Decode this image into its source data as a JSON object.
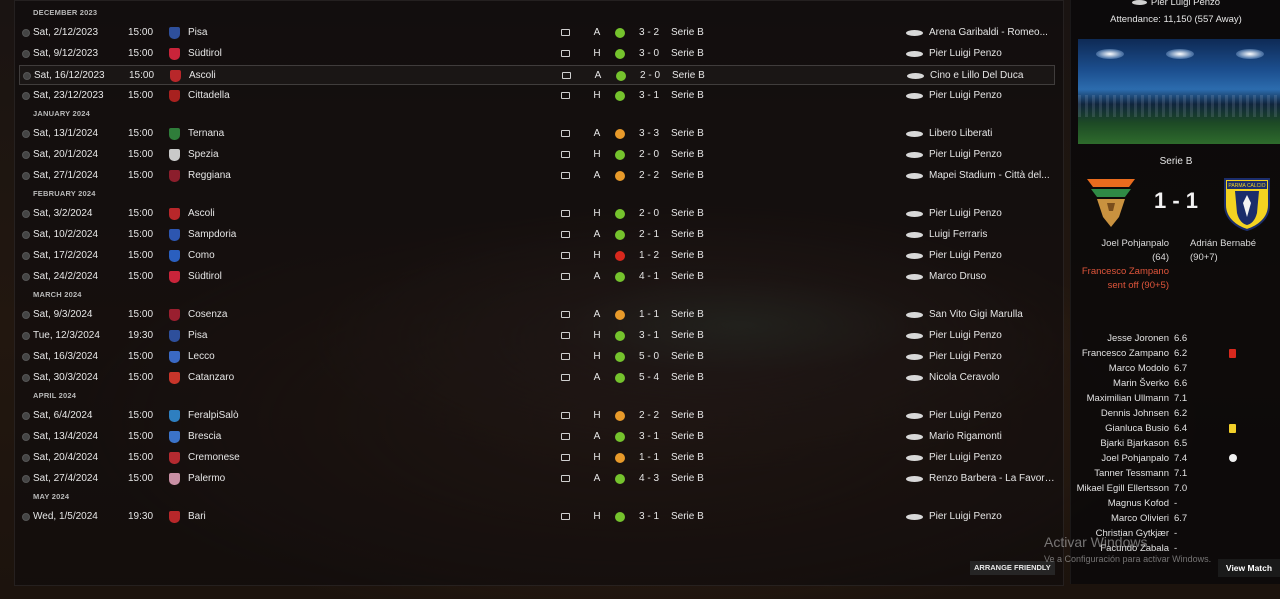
{
  "fixtures": {
    "months": [
      {
        "label": "DECEMBER 2023",
        "matches": [
          {
            "date": "Sat, 2/12/2023",
            "time": "15:00",
            "opponent": "Pisa",
            "badge_color": "#2e4f9b",
            "tv": "tv-icon",
            "venue": "A",
            "result": "win",
            "score": "3 - 2",
            "competition": "Serie B",
            "stadium": "Arena Garibaldi - Romeo..."
          },
          {
            "date": "Sat, 9/12/2023",
            "time": "15:00",
            "opponent": "Südtirol",
            "badge_color": "#c9243a",
            "tv": "tv-icon",
            "venue": "H",
            "result": "win",
            "score": "3 - 0",
            "competition": "Serie B",
            "stadium": "Pier Luigi Penzo"
          },
          {
            "date": "Sat, 16/12/2023",
            "time": "15:00",
            "opponent": "Ascoli",
            "badge_color": "#b8272a",
            "tv": "tv-icon",
            "venue": "A",
            "result": "win",
            "score": "2 - 0",
            "competition": "Serie B",
            "stadium": "Cino e Lillo Del Duca",
            "selected": true
          },
          {
            "date": "Sat, 23/12/2023",
            "time": "15:00",
            "opponent": "Cittadella",
            "badge_color": "#a8211f",
            "tv": "tv-icon",
            "venue": "H",
            "result": "win",
            "score": "3 - 1",
            "competition": "Serie B",
            "stadium": "Pier Luigi Penzo"
          }
        ]
      },
      {
        "label": "JANUARY 2024",
        "matches": [
          {
            "date": "Sat, 13/1/2024",
            "time": "15:00",
            "opponent": "Ternana",
            "badge_color": "#2f7d3a",
            "tv": "tv-icon",
            "venue": "A",
            "result": "draw",
            "score": "3 - 3",
            "competition": "Serie B",
            "stadium": "Libero Liberati"
          },
          {
            "date": "Sat, 20/1/2024",
            "time": "15:00",
            "opponent": "Spezia",
            "badge_color": "#c9c9c9",
            "tv": "tv-icon",
            "venue": "H",
            "result": "win",
            "score": "2 - 0",
            "competition": "Serie B",
            "stadium": "Pier Luigi Penzo"
          },
          {
            "date": "Sat, 27/1/2024",
            "time": "15:00",
            "opponent": "Reggiana",
            "badge_color": "#8c1e2c",
            "tv": "tv-icon",
            "venue": "A",
            "result": "draw",
            "score": "2 - 2",
            "competition": "Serie B",
            "stadium": "Mapei Stadium - Città del..."
          }
        ]
      },
      {
        "label": "FEBRUARY 2024",
        "matches": [
          {
            "date": "Sat, 3/2/2024",
            "time": "15:00",
            "opponent": "Ascoli",
            "badge_color": "#b8272a",
            "tv": "tv-icon",
            "venue": "H",
            "result": "win",
            "score": "2 - 0",
            "competition": "Serie B",
            "stadium": "Pier Luigi Penzo"
          },
          {
            "date": "Sat, 10/2/2024",
            "time": "15:00",
            "opponent": "Sampdoria",
            "badge_color": "#2d56b0",
            "tv": "tv-icon",
            "venue": "A",
            "result": "win",
            "score": "2 - 1",
            "competition": "Serie B",
            "stadium": "Luigi Ferraris"
          },
          {
            "date": "Sat, 17/2/2024",
            "time": "15:00",
            "opponent": "Como",
            "badge_color": "#2a5fbf",
            "tv": "tv-icon",
            "venue": "H",
            "result": "loss",
            "score": "1 - 2",
            "competition": "Serie B",
            "stadium": "Pier Luigi Penzo"
          },
          {
            "date": "Sat, 24/2/2024",
            "time": "15:00",
            "opponent": "Südtirol",
            "badge_color": "#c9243a",
            "tv": "tv-icon",
            "venue": "A",
            "result": "win",
            "score": "4 - 1",
            "competition": "Serie B",
            "stadium": "Marco Druso"
          }
        ]
      },
      {
        "label": "MARCH 2024",
        "matches": [
          {
            "date": "Sat, 9/3/2024",
            "time": "15:00",
            "opponent": "Cosenza",
            "badge_color": "#9a1f2f",
            "tv": "tv-icon",
            "venue": "A",
            "result": "draw",
            "score": "1 - 1",
            "competition": "Serie B",
            "stadium": "San Vito Gigi Marulla"
          },
          {
            "date": "Tue, 12/3/2024",
            "time": "19:30",
            "opponent": "Pisa",
            "badge_color": "#2e4f9b",
            "tv": "tv-icon",
            "venue": "H",
            "result": "win",
            "score": "3 - 1",
            "competition": "Serie B",
            "stadium": "Pier Luigi Penzo"
          },
          {
            "date": "Sat, 16/3/2024",
            "time": "15:00",
            "opponent": "Lecco",
            "badge_color": "#3a69c4",
            "tv": "tv-icon",
            "venue": "H",
            "result": "win",
            "score": "5 - 0",
            "competition": "Serie B",
            "stadium": "Pier Luigi Penzo"
          },
          {
            "date": "Sat, 30/3/2024",
            "time": "15:00",
            "opponent": "Catanzaro",
            "badge_color": "#c8352a",
            "tv": "tv-icon",
            "venue": "A",
            "result": "win",
            "score": "5 - 4",
            "competition": "Serie B",
            "stadium": "Nicola Ceravolo"
          }
        ]
      },
      {
        "label": "APRIL 2024",
        "matches": [
          {
            "date": "Sat, 6/4/2024",
            "time": "15:00",
            "opponent": "FeralpiSalò",
            "badge_color": "#2e7fc0",
            "tv": "tv-icon",
            "venue": "H",
            "result": "draw",
            "score": "2 - 2",
            "competition": "Serie B",
            "stadium": "Pier Luigi Penzo"
          },
          {
            "date": "Sat, 13/4/2024",
            "time": "15:00",
            "opponent": "Brescia",
            "badge_color": "#3b73c9",
            "tv": "tv-icon",
            "venue": "A",
            "result": "win",
            "score": "3 - 1",
            "competition": "Serie B",
            "stadium": "Mario Rigamonti"
          },
          {
            "date": "Sat, 20/4/2024",
            "time": "15:00",
            "opponent": "Cremonese",
            "badge_color": "#b52a30",
            "tv": "tv-icon",
            "venue": "H",
            "result": "draw",
            "score": "1 - 1",
            "competition": "Serie B",
            "stadium": "Pier Luigi Penzo"
          },
          {
            "date": "Sat, 27/4/2024",
            "time": "15:00",
            "opponent": "Palermo",
            "badge_color": "#c98fa4",
            "tv": "tv-icon",
            "venue": "A",
            "result": "win",
            "score": "4 - 3",
            "competition": "Serie B",
            "stadium": "Renzo Barbera - La Favorita"
          }
        ]
      },
      {
        "label": "MAY 2024",
        "matches": [
          {
            "date": "Wed, 1/5/2024",
            "time": "19:30",
            "opponent": "Bari",
            "badge_color": "#b8272a",
            "tv": "tv-icon",
            "venue": "H",
            "result": "win",
            "score": "3 - 1",
            "competition": "Serie B",
            "stadium": "Pier Luigi Penzo"
          }
        ]
      }
    ],
    "arrange_friendly": "ARRANGE FRIENDLY"
  },
  "match_panel": {
    "stadium": "Pier Luigi Penzo",
    "attendance": "Attendance: 11,150 (557 Away)",
    "competition": "Serie B",
    "home_crest": "venezia-crest",
    "away_crest": "parma-crest",
    "away_crest_text": "PARMA CALCIO",
    "score": "1 - 1",
    "home_scorer": "Joel Pohjanpalo (64)",
    "away_scorer": "Adrián Bernabé (90+7)",
    "sent_off": "Francesco Zampano sent off (90+5)",
    "ratings": [
      {
        "name": "Jesse Joronen",
        "rating": "6.6",
        "icon": ""
      },
      {
        "name": "Francesco Zampano",
        "rating": "6.2",
        "icon": "red-card"
      },
      {
        "name": "Marco Modolo",
        "rating": "6.7",
        "icon": ""
      },
      {
        "name": "Marin Šverko",
        "rating": "6.6",
        "icon": ""
      },
      {
        "name": "Maximilian Ullmann",
        "rating": "7.1",
        "icon": ""
      },
      {
        "name": "Dennis Johnsen",
        "rating": "6.2",
        "icon": ""
      },
      {
        "name": "Gianluca Busio",
        "rating": "6.4",
        "icon": "yellow-card"
      },
      {
        "name": "Bjarki Bjarkason",
        "rating": "6.5",
        "icon": ""
      },
      {
        "name": "Joel Pohjanpalo",
        "rating": "7.4",
        "icon": "goal-ball"
      },
      {
        "name": "Tanner Tessmann",
        "rating": "7.1",
        "icon": ""
      },
      {
        "name": "Mikael Egill Ellertsson",
        "rating": "7.0",
        "icon": ""
      },
      {
        "name": "Magnus Kofod",
        "rating": "-",
        "icon": ""
      },
      {
        "name": "Marco Olivieri",
        "rating": "6.7",
        "icon": ""
      },
      {
        "name": "Christian Gytkjær",
        "rating": "-",
        "icon": ""
      },
      {
        "name": "Facundo Zabala",
        "rating": "-",
        "icon": ""
      }
    ],
    "view_match": "View Match"
  },
  "watermark": {
    "title": "Activar Windows",
    "subtitle": "Ve a Configuración para activar Windows."
  },
  "colors": {
    "win": "#75c32d",
    "draw": "#e89a2a",
    "loss": "#d8281d",
    "sent_off": "#e0553b"
  }
}
